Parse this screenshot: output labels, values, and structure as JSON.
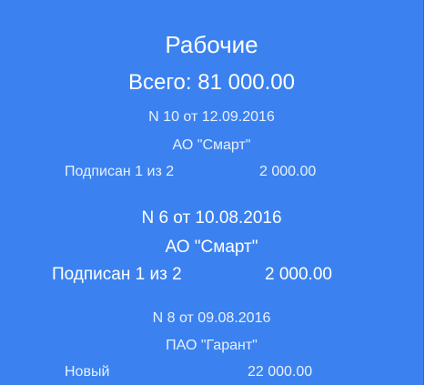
{
  "header": {
    "title": "Рабочие",
    "total": "Всего: 81 000.00"
  },
  "documents": [
    {
      "number_date": "N 10 от 12.09.2016",
      "company": "АО \"Смарт\"",
      "status": "Подписан 1 из 2",
      "amount": "2 000.00"
    },
    {
      "number_date": "N 6 от 10.08.2016",
      "company": "АО \"Смарт\"",
      "status": "Подписан 1 из 2",
      "amount": "2 000.00"
    },
    {
      "number_date": "N 8 от 09.08.2016",
      "company": "ПАО \"Гарант\"",
      "status": "Новый",
      "amount": "22 000.00"
    }
  ],
  "colors": {
    "background": "#3b82f0",
    "text": "#ffffff"
  }
}
